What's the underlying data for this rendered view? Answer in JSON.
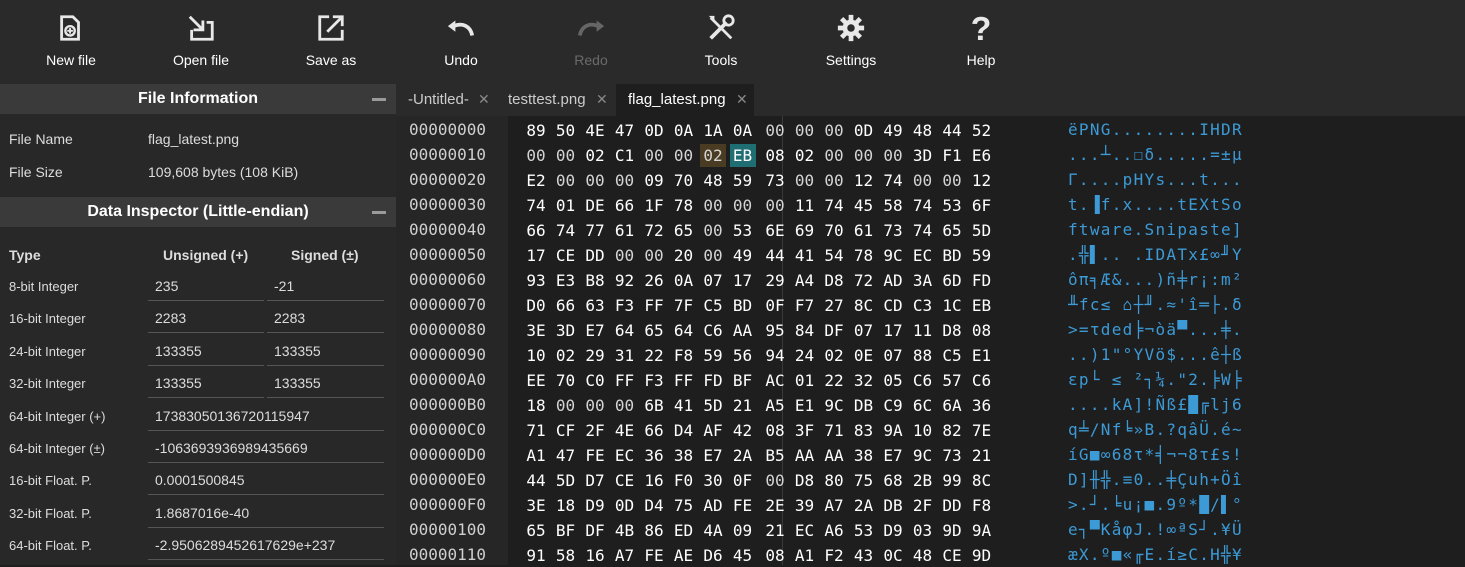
{
  "toolbar": {
    "buttons": [
      {
        "label": "New file",
        "icon": "new-file-icon",
        "enabled": true
      },
      {
        "label": "Open file",
        "icon": "open-file-icon",
        "enabled": true
      },
      {
        "label": "Save as",
        "icon": "save-as-icon",
        "enabled": true
      },
      {
        "label": "Undo",
        "icon": "undo-icon",
        "enabled": true
      },
      {
        "label": "Redo",
        "icon": "redo-icon",
        "enabled": false
      },
      {
        "label": "Tools",
        "icon": "tools-icon",
        "enabled": true
      },
      {
        "label": "Settings",
        "icon": "gear-icon",
        "enabled": true
      },
      {
        "label": "Help",
        "icon": "help-icon",
        "enabled": true
      }
    ]
  },
  "file_info": {
    "title": "File Information",
    "rows": [
      {
        "label": "File Name",
        "value": "flag_latest.png"
      },
      {
        "label": "File Size",
        "value": "109,608 bytes (108 KiB)"
      }
    ]
  },
  "data_inspector": {
    "title": "Data Inspector (Little-endian)",
    "headers": {
      "type": "Type",
      "unsigned": "Unsigned (+)",
      "signed": "Signed (±)"
    },
    "rows": [
      {
        "type": "8-bit Integer",
        "unsigned": "235",
        "signed": "-21"
      },
      {
        "type": "16-bit Integer",
        "unsigned": "2283",
        "signed": "2283"
      },
      {
        "type": "24-bit Integer",
        "unsigned": "133355",
        "signed": "133355"
      },
      {
        "type": "32-bit Integer",
        "unsigned": "133355",
        "signed": "133355"
      },
      {
        "type": "64-bit Integer (+)",
        "value": "17383050136720115947"
      },
      {
        "type": "64-bit Integer (±)",
        "value": "-1063693936989435669"
      },
      {
        "type": "16-bit Float. P.",
        "value": "0.0001500845"
      },
      {
        "type": "32-bit Float. P.",
        "value": "1.8687016e-40"
      },
      {
        "type": "64-bit Float. P.",
        "value": "-2.9506289452617629e+237"
      }
    ]
  },
  "tabs": [
    {
      "label": "-Untitled-",
      "active": false
    },
    {
      "label": "testtest.png",
      "active": false
    },
    {
      "label": "flag_latest.png",
      "active": true
    }
  ],
  "hex": {
    "rows": [
      {
        "offset": "00000000",
        "bytes": [
          "89",
          "50",
          "4E",
          "47",
          "0D",
          "0A",
          "1A",
          "0A",
          "00",
          "00",
          "00",
          "0D",
          "49",
          "48",
          "44",
          "52"
        ],
        "ascii": "ëPNG........IHDR"
      },
      {
        "offset": "00000010",
        "bytes": [
          "00",
          "00",
          "02",
          "C1",
          "00",
          "00",
          "02",
          "EB",
          "08",
          "02",
          "00",
          "00",
          "00",
          "3D",
          "F1",
          "E6"
        ],
        "ascii": "...┴..☐δ.....=±µ"
      },
      {
        "offset": "00000020",
        "bytes": [
          "E2",
          "00",
          "00",
          "00",
          "09",
          "70",
          "48",
          "59",
          "73",
          "00",
          "00",
          "12",
          "74",
          "00",
          "00",
          "12"
        ],
        "ascii": "Γ....pHYs...t..."
      },
      {
        "offset": "00000030",
        "bytes": [
          "74",
          "01",
          "DE",
          "66",
          "1F",
          "78",
          "00",
          "00",
          "00",
          "11",
          "74",
          "45",
          "58",
          "74",
          "53",
          "6F"
        ],
        "ascii": "t.▐f.x....tEXtSo"
      },
      {
        "offset": "00000040",
        "bytes": [
          "66",
          "74",
          "77",
          "61",
          "72",
          "65",
          "00",
          "53",
          "6E",
          "69",
          "70",
          "61",
          "73",
          "74",
          "65",
          "5D"
        ],
        "ascii": "ftware.Snipaste]"
      },
      {
        "offset": "00000050",
        "bytes": [
          "17",
          "CE",
          "DD",
          "00",
          "00",
          "20",
          "00",
          "49",
          "44",
          "41",
          "54",
          "78",
          "9C",
          "EC",
          "BD",
          "59"
        ],
        "ascii": ".╬▌.. .IDATx£∞╜Y"
      },
      {
        "offset": "00000060",
        "bytes": [
          "93",
          "E3",
          "B8",
          "92",
          "26",
          "0A",
          "07",
          "17",
          "29",
          "A4",
          "D8",
          "72",
          "AD",
          "3A",
          "6D",
          "FD"
        ],
        "ascii": "ôπ╕Æ&...)ñ╪r¡:m²"
      },
      {
        "offset": "00000070",
        "bytes": [
          "D0",
          "66",
          "63",
          "F3",
          "FF",
          "7F",
          "C5",
          "BD",
          "0F",
          "F7",
          "27",
          "8C",
          "CD",
          "C3",
          "1C",
          "EB"
        ],
        "ascii": "╨fc≤ ⌂┼╜.≈'î═├.δ"
      },
      {
        "offset": "00000080",
        "bytes": [
          "3E",
          "3D",
          "E7",
          "64",
          "65",
          "64",
          "C6",
          "AA",
          "95",
          "84",
          "DF",
          "07",
          "17",
          "11",
          "D8",
          "08"
        ],
        "ascii": ">=τded╞¬òä▀...╪."
      },
      {
        "offset": "00000090",
        "bytes": [
          "10",
          "02",
          "29",
          "31",
          "22",
          "F8",
          "59",
          "56",
          "94",
          "24",
          "02",
          "0E",
          "07",
          "88",
          "C5",
          "E1"
        ],
        "ascii": "..)1\"°YVö$...ê┼ß"
      },
      {
        "offset": "000000A0",
        "bytes": [
          "EE",
          "70",
          "C0",
          "FF",
          "F3",
          "FF",
          "FD",
          "BF",
          "AC",
          "01",
          "22",
          "32",
          "05",
          "C6",
          "57",
          "C6"
        ],
        "ascii": "εp└ ≤ ²┐¼.\"2.╞W╞"
      },
      {
        "offset": "000000B0",
        "bytes": [
          "18",
          "00",
          "00",
          "00",
          "6B",
          "41",
          "5D",
          "21",
          "A5",
          "E1",
          "9C",
          "DB",
          "C9",
          "6C",
          "6A",
          "36"
        ],
        "ascii": "....kA]!Ñß£█╔lj6"
      },
      {
        "offset": "000000C0",
        "bytes": [
          "71",
          "CF",
          "2F",
          "4E",
          "66",
          "D4",
          "AF",
          "42",
          "08",
          "3F",
          "71",
          "83",
          "9A",
          "10",
          "82",
          "7E"
        ],
        "ascii": "q╧/Nf╘»B.?qâÜ.é~"
      },
      {
        "offset": "000000D0",
        "bytes": [
          "A1",
          "47",
          "FE",
          "EC",
          "36",
          "38",
          "E7",
          "2A",
          "B5",
          "AA",
          "AA",
          "38",
          "E7",
          "9C",
          "73",
          "21"
        ],
        "ascii": "íG■∞68τ*╡¬¬8τ£s!"
      },
      {
        "offset": "000000E0",
        "bytes": [
          "44",
          "5D",
          "D7",
          "CE",
          "16",
          "F0",
          "30",
          "0F",
          "00",
          "D8",
          "80",
          "75",
          "68",
          "2B",
          "99",
          "8C"
        ],
        "ascii": "D]╫╬.≡0..╪Çuh+Öî"
      },
      {
        "offset": "000000F0",
        "bytes": [
          "3E",
          "18",
          "D9",
          "0D",
          "D4",
          "75",
          "AD",
          "FE",
          "2E",
          "39",
          "A7",
          "2A",
          "DB",
          "2F",
          "DD",
          "F8"
        ],
        "ascii": ">.┘.╘u¡■.9º*█/▌°"
      },
      {
        "offset": "00000100",
        "bytes": [
          "65",
          "BF",
          "DF",
          "4B",
          "86",
          "ED",
          "4A",
          "09",
          "21",
          "EC",
          "A6",
          "53",
          "D9",
          "03",
          "9D",
          "9A"
        ],
        "ascii": "e┐▀KåφJ.!∞ªS┘.¥Ü"
      },
      {
        "offset": "00000110",
        "bytes": [
          "91",
          "58",
          "16",
          "A7",
          "FE",
          "AE",
          "D6",
          "45",
          "08",
          "A1",
          "F2",
          "43",
          "0C",
          "48",
          "CE",
          "9D"
        ],
        "ascii": "æX.º■«╓E.í≥C.H╬¥"
      }
    ],
    "selected": {
      "row": 1,
      "col": 7
    },
    "highlighted": {
      "row": 1,
      "col": 6
    }
  }
}
